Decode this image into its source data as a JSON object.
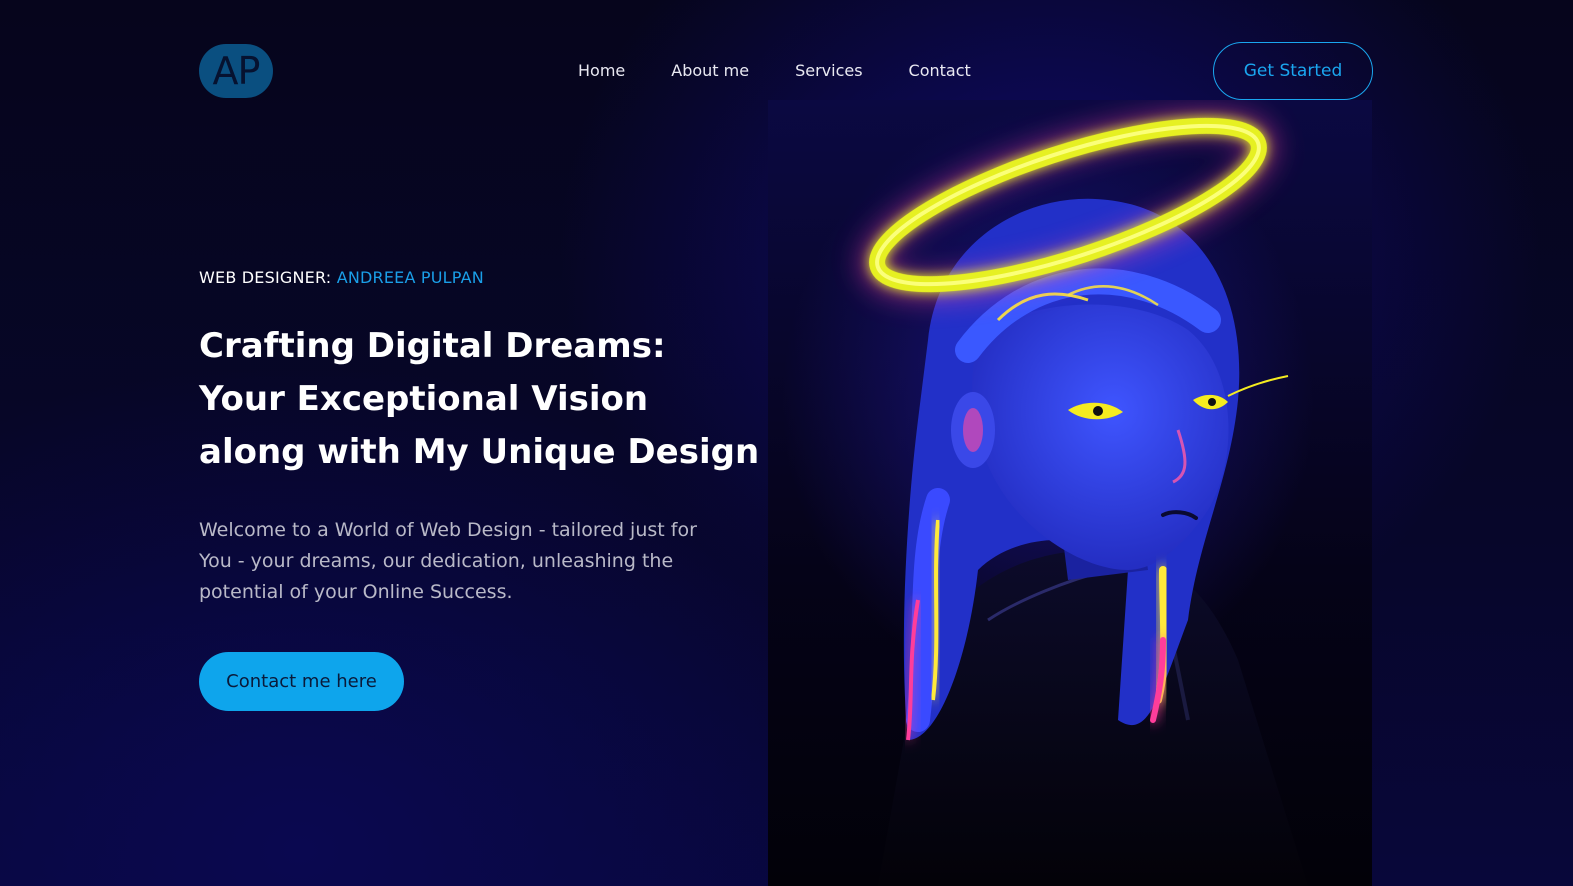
{
  "header": {
    "logo_text": "AP",
    "nav": [
      "Home",
      "About me",
      "Services",
      "Contact"
    ],
    "cta_label": "Get Started"
  },
  "hero": {
    "eyebrow_label": "WEB DESIGNER:",
    "eyebrow_name": "ANDREEA PULPAN",
    "headline_lines": [
      "Crafting Digital Dreams:",
      "Your Exceptional Vision",
      "along with My Unique Design"
    ],
    "intro": "Welcome to a World of Web Design - tailored just for You - your dreams, our dedication, unleashing the potential of your Online Success.",
    "cta_label": "Contact me here"
  },
  "colors": {
    "accent": "#1aa6ef",
    "button_fill": "#0ea5ec",
    "background": "#07062a",
    "halo": "#e6f020",
    "portrait_skin": "#2b3de0"
  }
}
